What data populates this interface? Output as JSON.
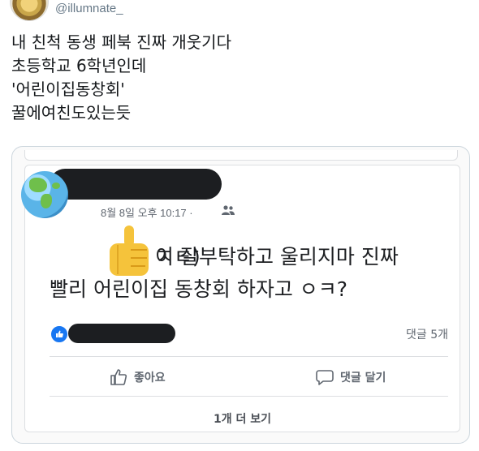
{
  "tweet": {
    "handle": "@illumnate_",
    "lines": [
      "내 친척 동생 페북 진짜 개웃기다",
      "초등학교 6학년인데",
      "'어린이집동창회'",
      "꿀에여친도있는듯"
    ]
  },
  "facebook_post": {
    "meta": "8월 8일 오후 10:17 ·",
    "privacy_icon": "people-icon",
    "post_prefix": "ㅈㅌ)",
    "post_line1": "이 잘부탁하고 울리지마 진짜",
    "post_line2": "빨리 어린이집 동창회 하자고 ㅇㅋ?",
    "comment_count": "댓글 5개",
    "like_label": "좋아요",
    "comment_label": "댓글 달기",
    "more_replies": "1개 더 보기"
  },
  "colors": {
    "fb_blue": "#1877f2",
    "redaction": "#1c1e21",
    "muted_text": "#606770"
  }
}
